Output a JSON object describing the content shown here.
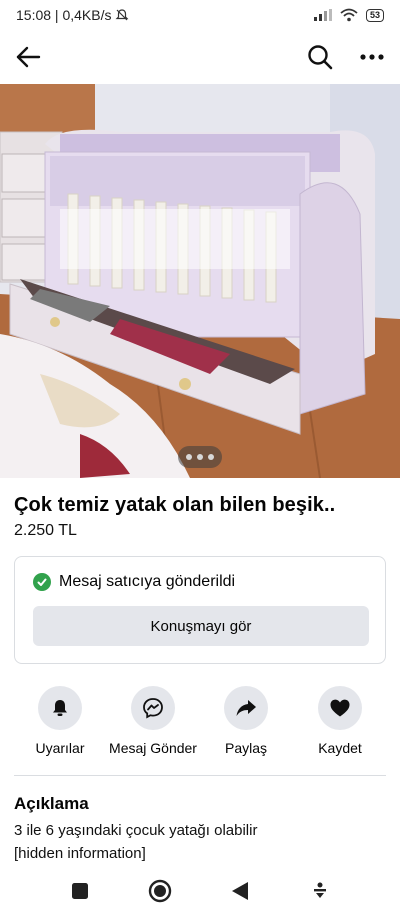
{
  "status_bar": {
    "time_net": "15:08 | 0,4KB/s",
    "battery": "53"
  },
  "toolbar": {
    "back_icon": "arrow-left-icon",
    "search_icon": "search-icon",
    "more_icon": "more-horizontal-icon"
  },
  "listing": {
    "title": "Çok temiz yatak olan bilen beşik..",
    "price": "2.250 TL",
    "photo_count_indicator": 3
  },
  "message_card": {
    "status": "Mesaj satıcıya gönderildi",
    "button_label": "Konuşmayı gör"
  },
  "actions": [
    {
      "label": "Uyarılar",
      "icon": "bell-icon"
    },
    {
      "label": "Mesaj Gönder",
      "icon": "messenger-icon"
    },
    {
      "label": "Paylaş",
      "icon": "share-icon"
    },
    {
      "label": "Kaydet",
      "icon": "heart-icon"
    }
  ],
  "description": {
    "heading": "Açıklama",
    "line1": "3 ile 6 yaşındaki çocuk yatağı olabilir",
    "line2": "[hidden information]"
  },
  "colors": {
    "success": "#31a24c",
    "button_bg": "#e4e6eb",
    "text": "#050505"
  }
}
